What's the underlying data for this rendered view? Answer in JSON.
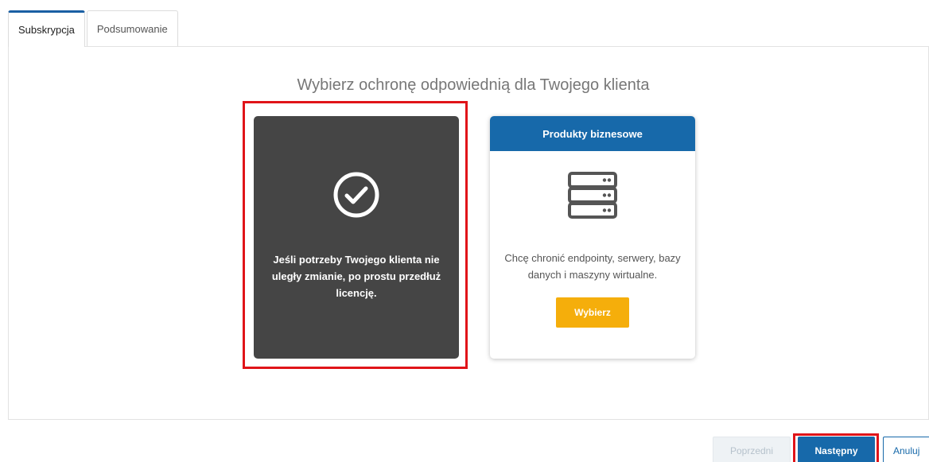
{
  "tabs": [
    {
      "label": "Subskrypcja",
      "active": true
    },
    {
      "label": "Podsumowanie",
      "active": false
    }
  ],
  "heading": "Wybierz ochronę odpowiednią dla Twojego klienta",
  "renew_card": {
    "icon": "check-circle-icon",
    "message": "Jeśli potrzeby Twojego klienta nie uległy zmianie, po prostu przedłuż licencję.",
    "highlighted": true
  },
  "business_card": {
    "title": "Produkty biznesowe",
    "icon": "server-icon",
    "description": "Chcę chronić endpointy, serwery, bazy danych i maszyny wirtualne.",
    "button_label": "Wybierz"
  },
  "footer": {
    "prev_label": "Poprzedni",
    "next_label": "Następny",
    "cancel_label": "Anuluj"
  },
  "colors": {
    "accent_blue": "#1769aa",
    "select_orange": "#f5ae0b",
    "highlight_red": "#e01419",
    "dark_card": "#454545"
  }
}
